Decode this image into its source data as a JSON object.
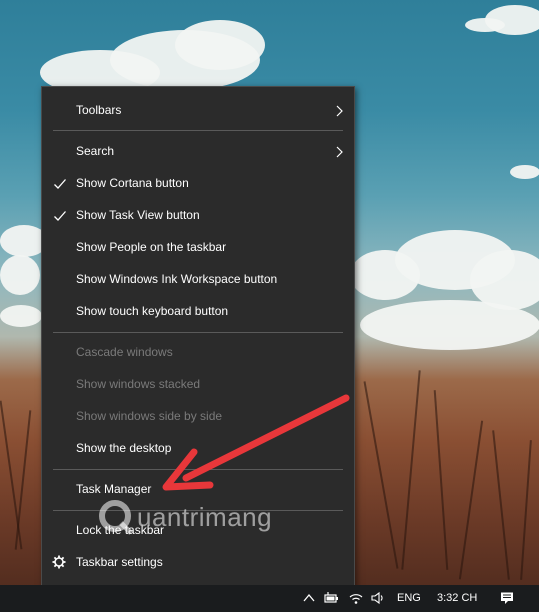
{
  "menu": {
    "items": [
      {
        "label": "Toolbars",
        "checked": false,
        "submenu": true,
        "enabled": true
      },
      {
        "label": "Search",
        "checked": false,
        "submenu": true,
        "enabled": true
      },
      {
        "label": "Show Cortana button",
        "checked": true,
        "submenu": false,
        "enabled": true
      },
      {
        "label": "Show Task View button",
        "checked": true,
        "submenu": false,
        "enabled": true
      },
      {
        "label": "Show People on the taskbar",
        "checked": false,
        "submenu": false,
        "enabled": true
      },
      {
        "label": "Show Windows Ink Workspace button",
        "checked": false,
        "submenu": false,
        "enabled": true
      },
      {
        "label": "Show touch keyboard button",
        "checked": false,
        "submenu": false,
        "enabled": true
      },
      {
        "label": "Cascade windows",
        "checked": false,
        "submenu": false,
        "enabled": false
      },
      {
        "label": "Show windows stacked",
        "checked": false,
        "submenu": false,
        "enabled": false
      },
      {
        "label": "Show windows side by side",
        "checked": false,
        "submenu": false,
        "enabled": false
      },
      {
        "label": "Show the desktop",
        "checked": false,
        "submenu": false,
        "enabled": true
      },
      {
        "label": "Task Manager",
        "checked": false,
        "submenu": false,
        "enabled": true
      },
      {
        "label": "Lock the taskbar",
        "checked": false,
        "submenu": false,
        "enabled": true
      },
      {
        "label": "Taskbar settings",
        "checked": false,
        "submenu": false,
        "enabled": true,
        "icon": "gear-icon"
      }
    ]
  },
  "taskbar": {
    "language": "ENG",
    "time": "3:32 CH"
  },
  "watermark": {
    "text": "uantrimang"
  },
  "colors": {
    "menu_bg": "#2b2b2b",
    "menu_text": "#ffffff",
    "menu_disabled_text": "#7a7a7a",
    "taskbar_bg": "#1a1c1e",
    "arrow": "#e8373a"
  }
}
